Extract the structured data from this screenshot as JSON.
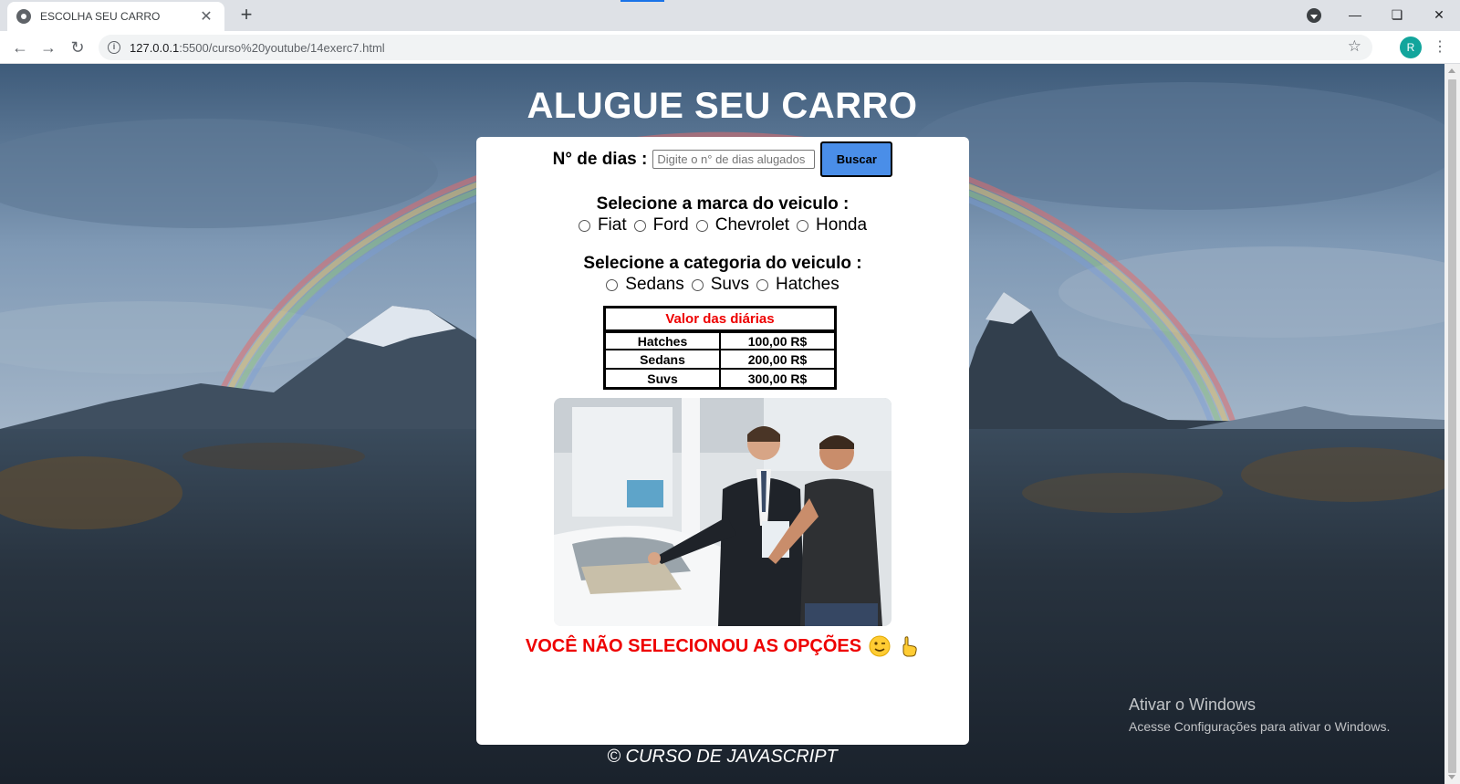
{
  "browser": {
    "tab_title": "ESCOLHA SEU CARRO",
    "tab_close": "✕",
    "new_tab": "+",
    "url_host": "127.0.0.1",
    "url_path": ":5500/curso%20youtube/14exerc7.html",
    "profile_initial": "R",
    "icons": [
      "back-icon",
      "forward-icon",
      "reload-icon",
      "info-icon",
      "star-icon",
      "menu-icon"
    ]
  },
  "page": {
    "title": "ALUGUE SEU CARRO",
    "dias_label": "N° de dias :",
    "dias_placeholder": "Digite o n° de dias alugados",
    "buscar_label": "Buscar",
    "marca_title": "Selecione a marca do veiculo :",
    "marcas": [
      "Fiat",
      "Ford",
      "Chevrolet",
      "Honda"
    ],
    "categoria_title": "Selecione a categoria do veiculo :",
    "categorias": [
      "Sedans",
      "Suvs",
      "Hatches"
    ],
    "table": {
      "header": "Valor das diárias",
      "rows": [
        {
          "categoria": "Hatches",
          "valor": "100,00 R$"
        },
        {
          "categoria": "Sedans",
          "valor": "200,00 R$"
        },
        {
          "categoria": "Suvs",
          "valor": "300,00 R$"
        }
      ]
    },
    "warning": "VOCÊ NÃO SELECIONOU AS OPÇÕES",
    "footer": "© CURSO DE JAVASCRIPT"
  },
  "windows_watermark": {
    "line1": "Ativar o Windows",
    "line2": "Acesse Configurações para ativar o Windows."
  },
  "colors": {
    "accent_button": "#4a8ee8",
    "warning_text": "#e00000",
    "profile": "#12a59c"
  }
}
